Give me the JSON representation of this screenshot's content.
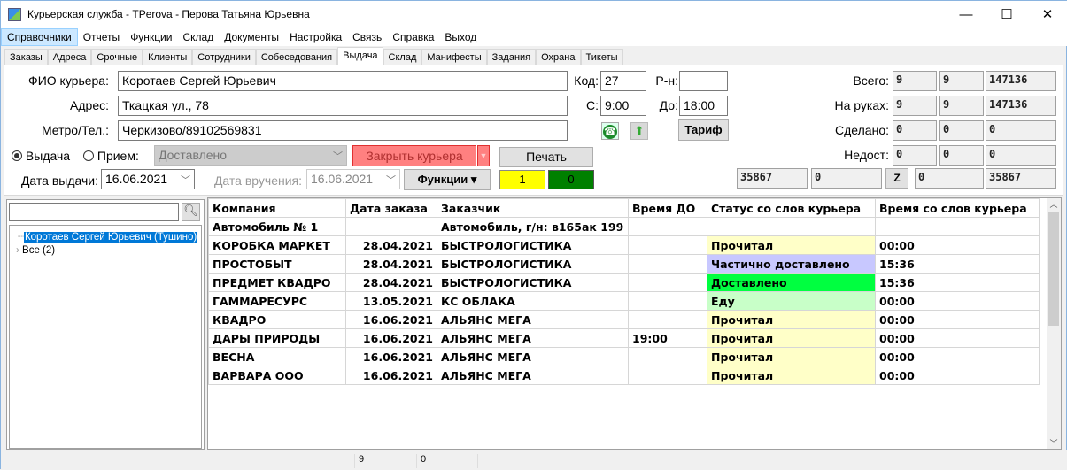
{
  "window": {
    "title": "Курьерская служба - TPerova - Перова Татьяна Юрьевна",
    "minimize": "—",
    "maximize": "☐",
    "close": "✕"
  },
  "menu": [
    "Справочники",
    "Отчеты",
    "Функции",
    "Склад",
    "Документы",
    "Настройка",
    "Связь",
    "Справка",
    "Выход"
  ],
  "tabs": [
    "Заказы",
    "Адреса",
    "Срочные",
    "Клиенты",
    "Сотрудники",
    "Собеседования",
    "Выдача",
    "Склад",
    "Манифесты",
    "Задания",
    "Охрана",
    "Тикеты"
  ],
  "active_tab": "Выдача",
  "form": {
    "fio_label": "ФИО курьера:",
    "fio": "Коротаев Сергей Юрьевич",
    "address_label": "Адрес:",
    "address": "Ткацкая ул., 78",
    "metro_label": "Метро/Тел.:",
    "metro": "Черкизово/89102569831",
    "code_label": "Код:",
    "code": "27",
    "district_label": "Р-н:",
    "district": "",
    "from_label": "С:",
    "from": "9:00",
    "to_label": "До:",
    "to": "18:00",
    "tariff": "Тариф",
    "radio_issue": "Выдача",
    "radio_receive": "Прием:",
    "status_select": "Доставлено",
    "close_courier": "Закрыть курьера",
    "print": "Печать",
    "issue_date_label": "Дата выдачи:",
    "issue_date": "16.06.2021",
    "delivery_date_label": "Дата вручения:",
    "delivery_date": "16.06.2021",
    "functions": "Функции ▾",
    "yellow_count": "1",
    "green_count": "0",
    "colors": {
      "yellow": "#ffff00",
      "green": "#008000",
      "close": "#ff8080"
    }
  },
  "counters": {
    "rows": [
      {
        "label": "Всего:",
        "values": [
          "9",
          "9",
          "147136"
        ]
      },
      {
        "label": "На руках:",
        "values": [
          "9",
          "9",
          "147136"
        ]
      },
      {
        "label": "Сделано:",
        "values": [
          "0",
          "0",
          "0"
        ]
      },
      {
        "label": "Недост:",
        "values": [
          "0",
          "0",
          "0"
        ]
      }
    ],
    "bottom": [
      "35867",
      "0",
      "0",
      "35867"
    ],
    "z_button": "Z"
  },
  "tree": {
    "search": "",
    "items": [
      "Коротаев Сергей Юрьевич (Тушино)",
      "Все (2)"
    ]
  },
  "table": {
    "columns": [
      "Компания",
      "Дата заказа",
      "Заказчик",
      "Время ДО",
      "Статус со слов курьера",
      "Время со слов курьера"
    ],
    "rows": [
      [
        "Автомобиль № 1",
        "",
        "Автомобиль, г/н: в165ак 199",
        "",
        "",
        ""
      ],
      [
        "КОРОБКА МАРКЕТ",
        "28.04.2021",
        "БЫСТРОЛОГИСТИКА",
        "",
        "Прочитал",
        "00:00"
      ],
      [
        "ПРОСТОБЫТ",
        "28.04.2021",
        "БЫСТРОЛОГИСТИКА",
        "",
        "Частично доставлено",
        "15:36"
      ],
      [
        "ПРЕДМЕТ КВАДРО",
        "28.04.2021",
        "БЫСТРОЛОГИСТИКА",
        "",
        "Доставлено",
        "15:36"
      ],
      [
        "ГАММАРЕСУРС",
        "13.05.2021",
        "КС ОБЛАКА",
        "",
        "Еду",
        "00:00"
      ],
      [
        "КВАДРО",
        "16.06.2021",
        "АЛЬЯНС МЕГА",
        "",
        "Прочитал",
        "00:00"
      ],
      [
        "ДАРЫ ПРИРОДЫ",
        "16.06.2021",
        "АЛЬЯНС МЕГА",
        "19:00",
        "Прочитал",
        "00:00"
      ],
      [
        "ВЕСНА",
        "16.06.2021",
        "АЛЬЯНС МЕГА",
        "",
        "Прочитал",
        "00:00"
      ],
      [
        "ВАРВАРА ООО",
        "16.06.2021",
        "АЛЬЯНС МЕГА",
        "",
        "Прочитал",
        "00:00"
      ]
    ],
    "status_colors": {
      "Прочитал": "#ffffc8",
      "Частично доставлено": "#c8c8ff",
      "Доставлено": "#00ff40",
      "Еду": "#c8ffc8"
    }
  },
  "statusbar": [
    "9",
    "0"
  ]
}
